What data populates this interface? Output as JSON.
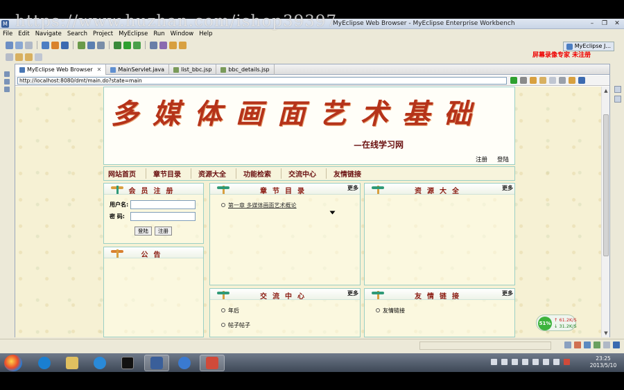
{
  "watermark": "https://www.huzhan.com/ishop39397",
  "window": {
    "title": "MyEclipse Web Browser - MyEclipse Enterprise Workbench",
    "recorder_label": "屏幕录像专家 未注册",
    "perspective": "MyEclipse J..."
  },
  "menu": [
    "File",
    "Edit",
    "Navigate",
    "Search",
    "Project",
    "MyEclipse",
    "Run",
    "Window",
    "Help"
  ],
  "tabs": [
    {
      "label": "MyEclipse Web Browser",
      "active": true
    },
    {
      "label": "MainServlet.java",
      "active": false
    },
    {
      "label": "list_bbc.jsp",
      "active": false
    },
    {
      "label": "bbc_details.jsp",
      "active": false
    }
  ],
  "browser": {
    "url": "http://localhost:8080/dmt/main.do?state=main"
  },
  "site": {
    "banner_title": "多媒体画面艺术基础",
    "banner_subtitle": "—在线学习网",
    "top_links": [
      "注册",
      "登陆"
    ],
    "nav": [
      "网站首页",
      "章节目录",
      "资源大全",
      "功能检索",
      "交流中心",
      "友情链接"
    ],
    "login": {
      "title": "会员注册",
      "username_label": "用户名:",
      "password_label": "密  码:",
      "login_button": "登陆",
      "register_button": "注册"
    },
    "notice": {
      "title": "公告"
    },
    "more": "更多",
    "chapters": {
      "title": "章节目录",
      "items": [
        "第一章 多媒体画面艺术概论"
      ]
    },
    "resources": {
      "title": "资源大全"
    },
    "forum": {
      "title": "交流中心",
      "items": [
        "年后",
        "帖子帖子"
      ]
    },
    "links": {
      "title": "友情链接",
      "items": [
        "友情链接"
      ]
    }
  },
  "network": {
    "percent": "51%",
    "up": "↑ 61.2K/S",
    "down": "↓ 31.2K/S"
  },
  "clock": {
    "time": "23:25",
    "date": "2013/5/10"
  },
  "colors": {
    "accent": "#8a1a10",
    "border": "#9bcfc4",
    "banner": "#b5331a"
  }
}
